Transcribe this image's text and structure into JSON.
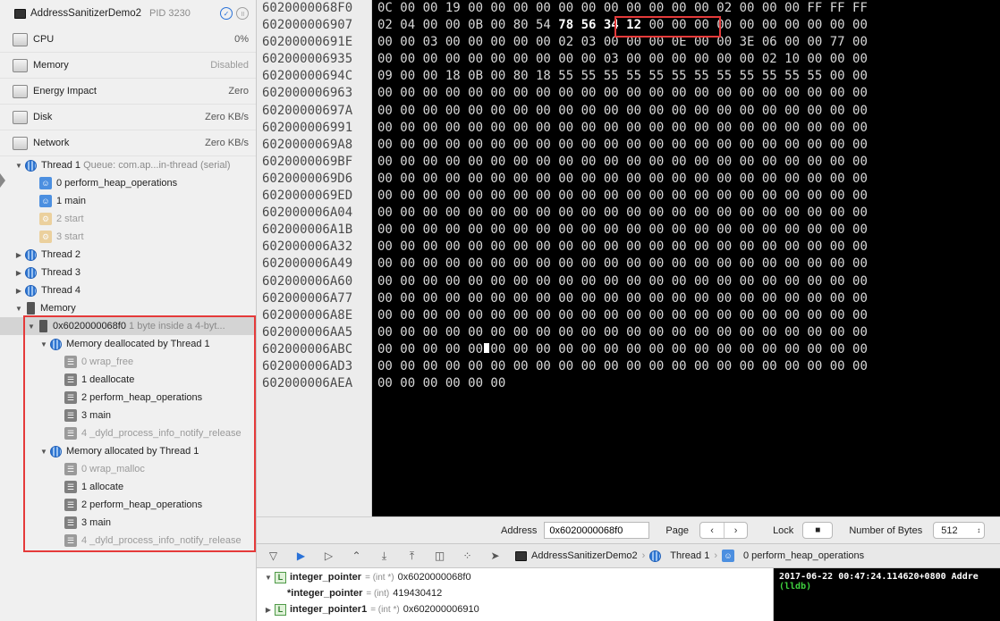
{
  "process": {
    "name": "AddressSanitizerDemo2",
    "pid": "PID 3230"
  },
  "gauges": [
    {
      "label": "CPU",
      "value": "0%"
    },
    {
      "label": "Memory",
      "value": "Disabled"
    },
    {
      "label": "Energy Impact",
      "value": "Zero"
    },
    {
      "label": "Disk",
      "value": "Zero KB/s"
    },
    {
      "label": "Network",
      "value": "Zero KB/s"
    }
  ],
  "thread1": {
    "label": "Thread 1",
    "queue": "Queue: com.ap...in-thread (serial)",
    "frames": [
      "0 perform_heap_operations",
      "1 main",
      "2 start",
      "3 start"
    ]
  },
  "other_threads": [
    "Thread 2",
    "Thread 3",
    "Thread 4"
  ],
  "memory_node": {
    "label": "Memory",
    "address": "0x6020000068f0",
    "desc": "1 byte inside a 4-byt...",
    "dealloc": {
      "label": "Memory deallocated by Thread 1",
      "frames": [
        "0 wrap_free",
        "1 deallocate",
        "2 perform_heap_operations",
        "3 main",
        "4 _dyld_process_info_notify_release"
      ]
    },
    "alloc": {
      "label": "Memory allocated by Thread 1",
      "frames": [
        "0 wrap_malloc",
        "1 allocate",
        "2 perform_heap_operations",
        "3 main",
        "4 _dyld_process_info_notify_release"
      ]
    }
  },
  "memory_browser": {
    "addresses": [
      "6020000068F0",
      "602000006907",
      "60200000691E",
      "602000006935",
      "60200000694C",
      "602000006963",
      "60200000697A",
      "602000006991",
      "6020000069A8",
      "6020000069BF",
      "6020000069D6",
      "6020000069ED",
      "602000006A04",
      "602000006A1B",
      "602000006A32",
      "602000006A49",
      "602000006A60",
      "602000006A77",
      "602000006A8E",
      "602000006AA5",
      "602000006ABC",
      "602000006AD3",
      "602000006AEA"
    ],
    "rows": [
      "0C 00 00 19 00 00 00 00 00 00 00 00 00 00 00 02 00 00 00 FF FF FF",
      "02 04 00 00 0B 00 80 54 78 56 34 12 00 00 00 00 00 00 00 00 00 00",
      "00 00 03 00 00 00 00 00 02 03 00 00 00 0E 00 00 3E 06 00 00 77 00",
      "00 00 00 00 00 00 00 00 00 00 03 00 00 00 00 00 00 02 10 00 00 00",
      "09 00 00 18 0B 00 80 18 55 55 55 55 55 55 55 55 55 55 55 55 00 00",
      "00 00 00 00 00 00 00 00 00 00 00 00 00 00 00 00 00 00 00 00 00 00",
      "00 00 00 00 00 00 00 00 00 00 00 00 00 00 00 00 00 00 00 00 00 00",
      "00 00 00 00 00 00 00 00 00 00 00 00 00 00 00 00 00 00 00 00 00 00",
      "00 00 00 00 00 00 00 00 00 00 00 00 00 00 00 00 00 00 00 00 00 00",
      "00 00 00 00 00 00 00 00 00 00 00 00 00 00 00 00 00 00 00 00 00 00",
      "00 00 00 00 00 00 00 00 00 00 00 00 00 00 00 00 00 00 00 00 00 00",
      "00 00 00 00 00 00 00 00 00 00 00 00 00 00 00 00 00 00 00 00 00 00",
      "00 00 00 00 00 00 00 00 00 00 00 00 00 00 00 00 00 00 00 00 00 00",
      "00 00 00 00 00 00 00 00 00 00 00 00 00 00 00 00 00 00 00 00 00 00",
      "00 00 00 00 00 00 00 00 00 00 00 00 00 00 00 00 00 00 00 00 00 00",
      "00 00 00 00 00 00 00 00 00 00 00 00 00 00 00 00 00 00 00 00 00 00",
      "00 00 00 00 00 00 00 00 00 00 00 00 00 00 00 00 00 00 00 00 00 00",
      "00 00 00 00 00 00 00 00 00 00 00 00 00 00 00 00 00 00 00 00 00 00",
      "00 00 00 00 00 00 00 00 00 00 00 00 00 00 00 00 00 00 00 00 00 00",
      "00 00 00 00 00 00 00 00 00 00 00 00 00 00 00 00 00 00 00 00 00 00",
      "00 00 00 00 00 00 00 00 00 00 00 00 00 00 00 00 00 00 00 00 00 00",
      "00 00 00 00 00 00 00 00 00 00 00 00 00 00 00 00 00 00 00 00 00 00",
      "00 00 00 00 00 00"
    ],
    "row1_prefix": "02 04 00 00 0B 00 80 54 ",
    "row1_highlight": "78 56 34 12",
    "row1_suffix": " 00 00 00 00 00 00 00 00 00 00"
  },
  "toolbar": {
    "address_label": "Address",
    "address_value": "0x6020000068f0",
    "page_label": "Page",
    "lock_label": "Lock",
    "bytes_label": "Number of Bytes",
    "bytes_value": "512"
  },
  "breadcrumb": {
    "app": "AddressSanitizerDemo2",
    "thread": "Thread 1",
    "frame": "0 perform_heap_operations"
  },
  "variables": [
    {
      "name": "integer_pointer",
      "type": "= (int *)",
      "value": "0x6020000068f0",
      "expandable": true,
      "expanded": true
    },
    {
      "name": "*integer_pointer",
      "type": "= (int)",
      "value": "419430412",
      "expandable": false,
      "child": true
    },
    {
      "name": "integer_pointer1",
      "type": "= (int *)",
      "value": "0x602000006910",
      "expandable": true,
      "expanded": false
    }
  ],
  "console": {
    "line1": "2017-06-22 00:47:24.114620+0800 Addre",
    "line2": "(lldb)"
  }
}
